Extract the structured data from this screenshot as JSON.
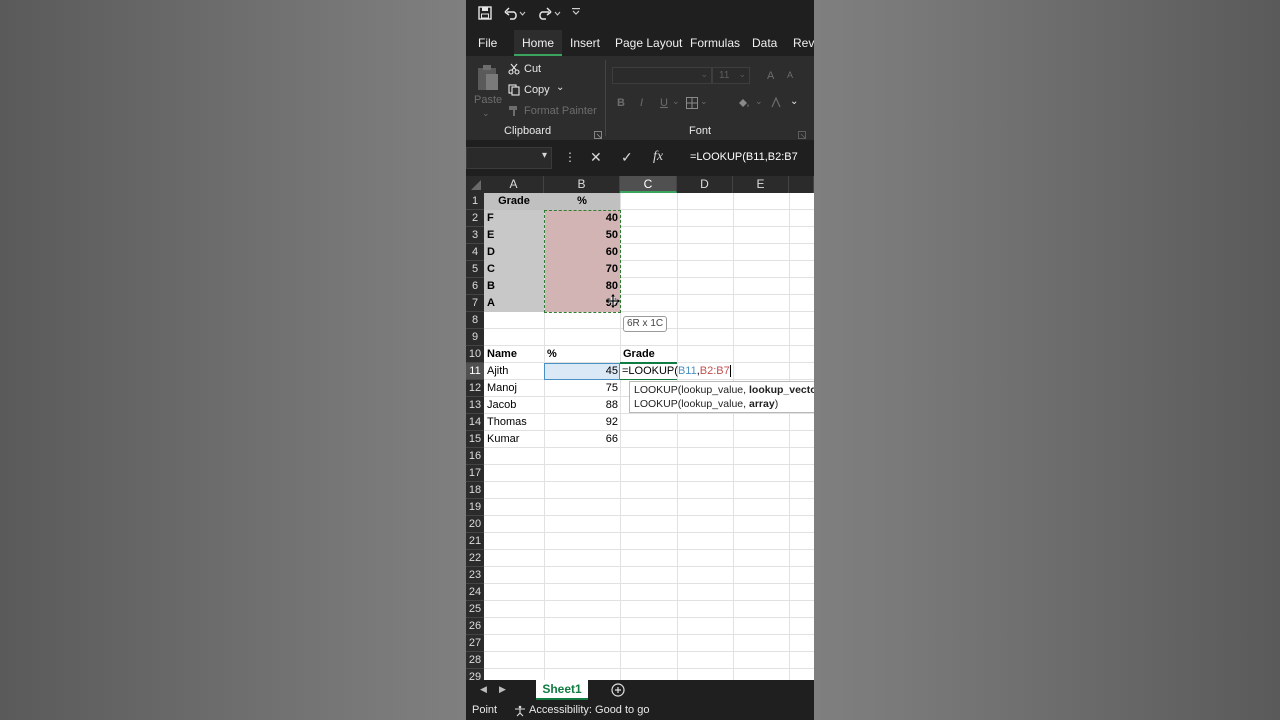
{
  "qat": {
    "save_icon": "save-icon",
    "undo_icon": "undo-icon",
    "redo_icon": "redo-icon"
  },
  "tabs": [
    "File",
    "Home",
    "Insert",
    "Page Layout",
    "Formulas",
    "Data",
    "Revi"
  ],
  "ribbon": {
    "paste": "Paste",
    "cut": "Cut",
    "copy": "Copy",
    "format_painter": "Format Painter",
    "clipboard_label": "Clipboard",
    "font_label": "Font",
    "font_size": "11",
    "grow_font": "A",
    "shrink_font": "A",
    "bold": "B",
    "italic": "I",
    "underline": "U"
  },
  "formula_bar": {
    "text": "=LOOKUP(B11,B2:B7",
    "cancel": "✕",
    "enter": "✓",
    "fx": "fx"
  },
  "columns": [
    "A",
    "B",
    "C",
    "D",
    "E"
  ],
  "rows": [
    "1",
    "2",
    "3",
    "4",
    "5",
    "6",
    "7",
    "8",
    "9",
    "10",
    "11",
    "12",
    "13",
    "14",
    "15",
    "16",
    "17",
    "18",
    "19",
    "20",
    "21",
    "22",
    "23",
    "24",
    "25",
    "26",
    "27",
    "28",
    "29"
  ],
  "grade_table": {
    "header_grade": "Grade",
    "header_pct": "%",
    "rows": [
      {
        "grade": "F",
        "pct": "40"
      },
      {
        "grade": "E",
        "pct": "50"
      },
      {
        "grade": "D",
        "pct": "60"
      },
      {
        "grade": "C",
        "pct": "70"
      },
      {
        "grade": "B",
        "pct": "80"
      },
      {
        "grade": "A",
        "pct": "90"
      }
    ]
  },
  "selection_tooltip": "6R x 1C",
  "student_table": {
    "header_name": "Name",
    "header_pct": "%",
    "header_grade": "Grade",
    "rows": [
      {
        "name": "Ajith",
        "pct": "45"
      },
      {
        "name": "Manoj",
        "pct": "75"
      },
      {
        "name": "Jacob",
        "pct": "88"
      },
      {
        "name": "Thomas",
        "pct": "92"
      },
      {
        "name": "Kumar",
        "pct": "66"
      }
    ]
  },
  "editing_cell": {
    "prefix": "=LOOKUP(",
    "arg1": "B11",
    "comma": ",",
    "arg2": "B2:B7"
  },
  "function_hint": {
    "line1_fn": "LOOKUP(",
    "line1_arg1": "lookup_value, ",
    "line1_arg2": "lookup_vector",
    "line2_fn": "LOOKUP(",
    "line2_arg1": "lookup_value, ",
    "line2_arg2": "array",
    "line2_close": ")"
  },
  "sheet_tab": "Sheet1",
  "status": {
    "mode": "Point",
    "accessibility": "Accessibility: Good to go"
  },
  "colors": {
    "accent_green": "#107c41",
    "ref_blue": "#4a90c2",
    "ref_red": "#c0504d"
  }
}
